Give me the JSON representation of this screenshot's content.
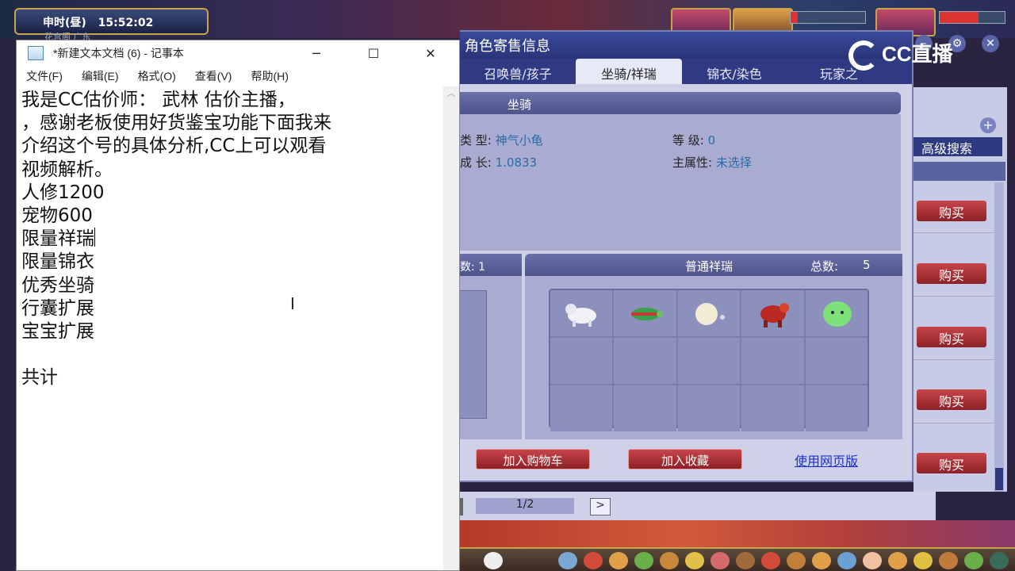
{
  "game": {
    "clock_label": "申时(昼)",
    "clock_time": "15:52:02",
    "clock_sub": "花宫阁 广东"
  },
  "notepad": {
    "title": "*新建文本文档 (6) - 记事本",
    "menu": [
      "文件(F)",
      "编辑(E)",
      "格式(O)",
      "查看(V)",
      "帮助(H)"
    ],
    "lines": [
      "我是CC估价师： 武林 估价主播，",
      "，感谢老板使用好货鉴宝功能下面我来",
      "介绍这个号的具体分析,CC上可以观看",
      "视频解析。",
      "人修1200",
      "宠物600",
      "限量祥瑞",
      "限量锦衣",
      "优秀坐骑",
      "行囊扩展",
      "宝宝扩展",
      "",
      "共计"
    ]
  },
  "dialog": {
    "title": "角色寄售信息",
    "tabs": [
      "召唤兽/孩子",
      "坐骑/祥瑞",
      "锦衣/染色",
      "玩家之"
    ],
    "active_tab": 1,
    "mount_header": "坐骑",
    "type_label": "类  型:",
    "type_value": "神气小龟",
    "level_label": "等  级:",
    "level_value": "0",
    "growth_label": "成  长:",
    "growth_value": "1.0833",
    "attr_label": "主属性:",
    "attr_value": "未选择",
    "left_header": "数: 1",
    "xiangrui_header": "普通祥瑞",
    "total_label": "总数:",
    "total_value": "5",
    "add_cart": "加入购物车",
    "add_fav": "加入收藏",
    "web_link": "使用网页版",
    "page": "1/2"
  },
  "right_panel": {
    "adv_search": "高级搜索",
    "buy_label": "购买"
  },
  "overlay": {
    "brand": "CC直播"
  },
  "colors": {
    "dialog_bg": "#cfd1e8",
    "tab_bar": "#2f3a82",
    "accent_red": "#b8333a",
    "value_blue": "#2a6aa8"
  }
}
